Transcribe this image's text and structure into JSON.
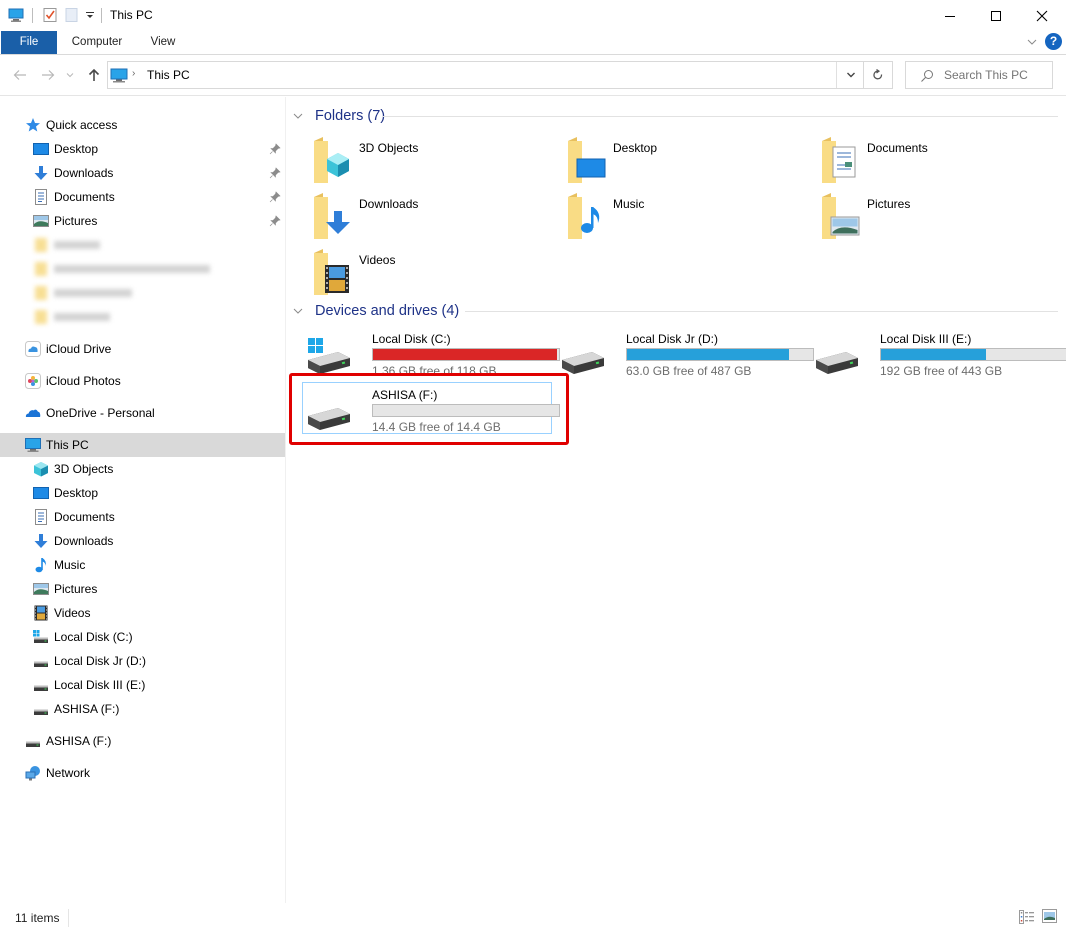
{
  "window": {
    "title": "This PC",
    "controls": {
      "minimize": "minimize",
      "maximize": "maximize",
      "close": "close"
    }
  },
  "quick_access_toolbar": {
    "icons": [
      "computer-icon",
      "properties-icon",
      "new-folder-icon",
      "customize-dropdown-icon"
    ]
  },
  "ribbon": {
    "tabs": [
      {
        "label": "File",
        "active": true
      },
      {
        "label": "Computer",
        "active": false
      },
      {
        "label": "View",
        "active": false
      }
    ],
    "help_label": "?"
  },
  "address": {
    "breadcrumb": [
      "This PC"
    ],
    "search_placeholder": "Search This PC"
  },
  "sidebar": {
    "quick_access": {
      "label": "Quick access",
      "items": [
        {
          "label": "Desktop",
          "icon": "desktop-icon",
          "pinned": true
        },
        {
          "label": "Downloads",
          "icon": "downloads-icon",
          "pinned": true
        },
        {
          "label": "Documents",
          "icon": "documents-icon",
          "pinned": true
        },
        {
          "label": "Pictures",
          "icon": "pictures-icon",
          "pinned": true
        },
        {
          "label": "[blurred]",
          "icon": "folder-icon",
          "pinned": false,
          "blurred": true
        },
        {
          "label": "[blurred]",
          "icon": "folder-icon",
          "pinned": false,
          "blurred": true
        },
        {
          "label": "[blurred]",
          "icon": "folder-icon",
          "pinned": false,
          "blurred": true
        },
        {
          "label": "[blurred]",
          "icon": "folder-icon",
          "pinned": false,
          "blurred": true
        }
      ]
    },
    "icloud_drive": "iCloud Drive",
    "icloud_photos": "iCloud Photos",
    "onedrive": "OneDrive - Personal",
    "this_pc": {
      "label": "This PC",
      "selected": true,
      "items": [
        {
          "label": "3D Objects",
          "icon": "3d-objects-icon"
        },
        {
          "label": "Desktop",
          "icon": "desktop-icon"
        },
        {
          "label": "Documents",
          "icon": "documents-icon"
        },
        {
          "label": "Downloads",
          "icon": "downloads-icon"
        },
        {
          "label": "Music",
          "icon": "music-icon"
        },
        {
          "label": "Pictures",
          "icon": "pictures-icon"
        },
        {
          "label": "Videos",
          "icon": "videos-icon"
        },
        {
          "label": "Local Disk (C:)",
          "icon": "system-drive-icon"
        },
        {
          "label": "Local Disk Jr (D:)",
          "icon": "drive-icon"
        },
        {
          "label": "Local Disk III (E:)",
          "icon": "drive-icon"
        },
        {
          "label": "ASHISA (F:)",
          "icon": "drive-icon"
        }
      ]
    },
    "removable": "ASHISA (F:)",
    "network": "Network"
  },
  "content": {
    "folders_group": {
      "label": "Folders (7)",
      "items": [
        {
          "label": "3D Objects",
          "icon": "3d-objects-folder-icon"
        },
        {
          "label": "Desktop",
          "icon": "desktop-folder-icon"
        },
        {
          "label": "Documents",
          "icon": "documents-folder-icon"
        },
        {
          "label": "Downloads",
          "icon": "downloads-folder-icon"
        },
        {
          "label": "Music",
          "icon": "music-folder-icon"
        },
        {
          "label": "Pictures",
          "icon": "pictures-folder-icon"
        },
        {
          "label": "Videos",
          "icon": "videos-folder-icon"
        }
      ]
    },
    "drives_group": {
      "label": "Devices and drives (4)",
      "items": [
        {
          "label": "Local Disk (C:)",
          "free_text": "1.36 GB free of 118 GB",
          "used_fraction": 0.988,
          "bar_color": "#da2626",
          "system": true
        },
        {
          "label": "Local Disk Jr (D:)",
          "free_text": "63.0 GB free of 487 GB",
          "used_fraction": 0.871,
          "bar_color": "#26a0da",
          "system": false
        },
        {
          "label": "Local Disk III (E:)",
          "free_text": "192 GB free of 443 GB",
          "used_fraction": 0.567,
          "bar_color": "#26a0da",
          "system": false
        },
        {
          "label": "ASHISA (F:)",
          "free_text": "14.4 GB free of 14.4 GB",
          "used_fraction": 0.0,
          "bar_color": "#26a0da",
          "system": false,
          "selected": true,
          "highlighted": true
        }
      ]
    }
  },
  "statusbar": {
    "item_count": "11 items",
    "views": [
      "details-view-icon",
      "large-icons-view-icon"
    ]
  },
  "colors": {
    "accent": "#1a5fa8",
    "group_header": "#1e3287",
    "drive_bar_normal": "#26a0da",
    "drive_bar_full": "#da2626",
    "highlight_box": "#e00000",
    "selection_bg": "#d9d9d9"
  }
}
